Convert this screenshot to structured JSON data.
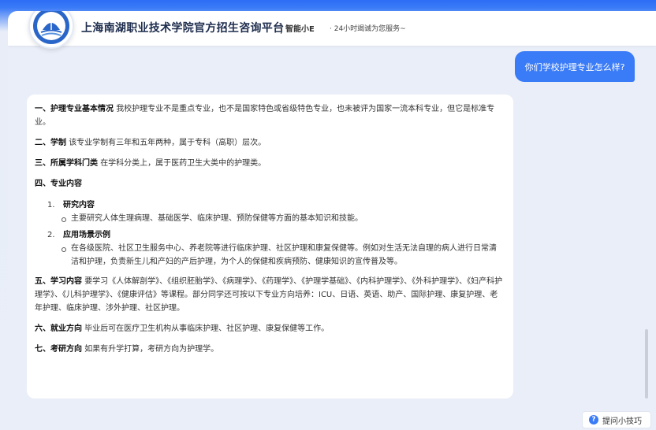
{
  "header": {
    "title": "上海南湖职业技术学院官方招生咨询平台",
    "assistant_name": "智能小E",
    "assistant_slogan": "· 24小时竭诚为您服务~"
  },
  "user_message": "你们学校护理专业怎么样?",
  "answer": {
    "s1_head": "一、护理专业基本情况",
    "s1_body": "我校护理专业不是重点专业，也不是国家特色或省级特色专业，也未被评为国家一流本科专业，但它是标准专业。",
    "s2_head": "二、学制",
    "s2_body": "该专业学制有三年和五年两种，属于专科（高职）层次。",
    "s3_head": "三、所属学科门类",
    "s3_body": "在学科分类上，属于医药卫生大类中的护理类。",
    "s4_head": "四、专业内容",
    "s4_item1_num": "1.",
    "s4_item1_title": "研究内容",
    "s4_item1_bullet": "主要研究人体生理病理、基础医学、临床护理、预防保健等方面的基本知识和技能。",
    "s4_item2_num": "2.",
    "s4_item2_title": "应用场景示例",
    "s4_item2_bullet": "在各级医院、社区卫生服务中心、养老院等进行临床护理、社区护理和康复保健等。例如对生活无法自理的病人进行日常清洁和护理，负责新生儿和产妇的产后护理，为个人的保健和疾病预防、健康知识的宣传普及等。",
    "s5_head": "五、学习内容",
    "s5_body": "要学习《人体解剖学》、《组织胚胎学》、《病理学》、《药理学》、《护理学基础》、《内科护理学》、《外科护理学》、《妇产科护理学》、《儿科护理学》、《健康评估》等课程。部分同学还可按以下专业方向培养：ICU、日语、英语、助产、国际护理、康复护理、老年护理、临床护理、涉外护理、社区护理。",
    "s6_head": "六、就业方向",
    "s6_body": "毕业后可在医疗卫生机构从事临床护理、社区护理、康复保健等工作。",
    "s7_head": "七、考研方向",
    "s7_body": "如果有升学打算，考研方向为护理学。"
  },
  "tips": {
    "icon_glyph": "?",
    "label": "提问小技巧"
  },
  "colors": {
    "brand_blue": "#3a7bf7",
    "page_bg": "#e9eef8"
  },
  "icons": {
    "logo": "school-emblem-icon",
    "tips": "question-icon"
  }
}
